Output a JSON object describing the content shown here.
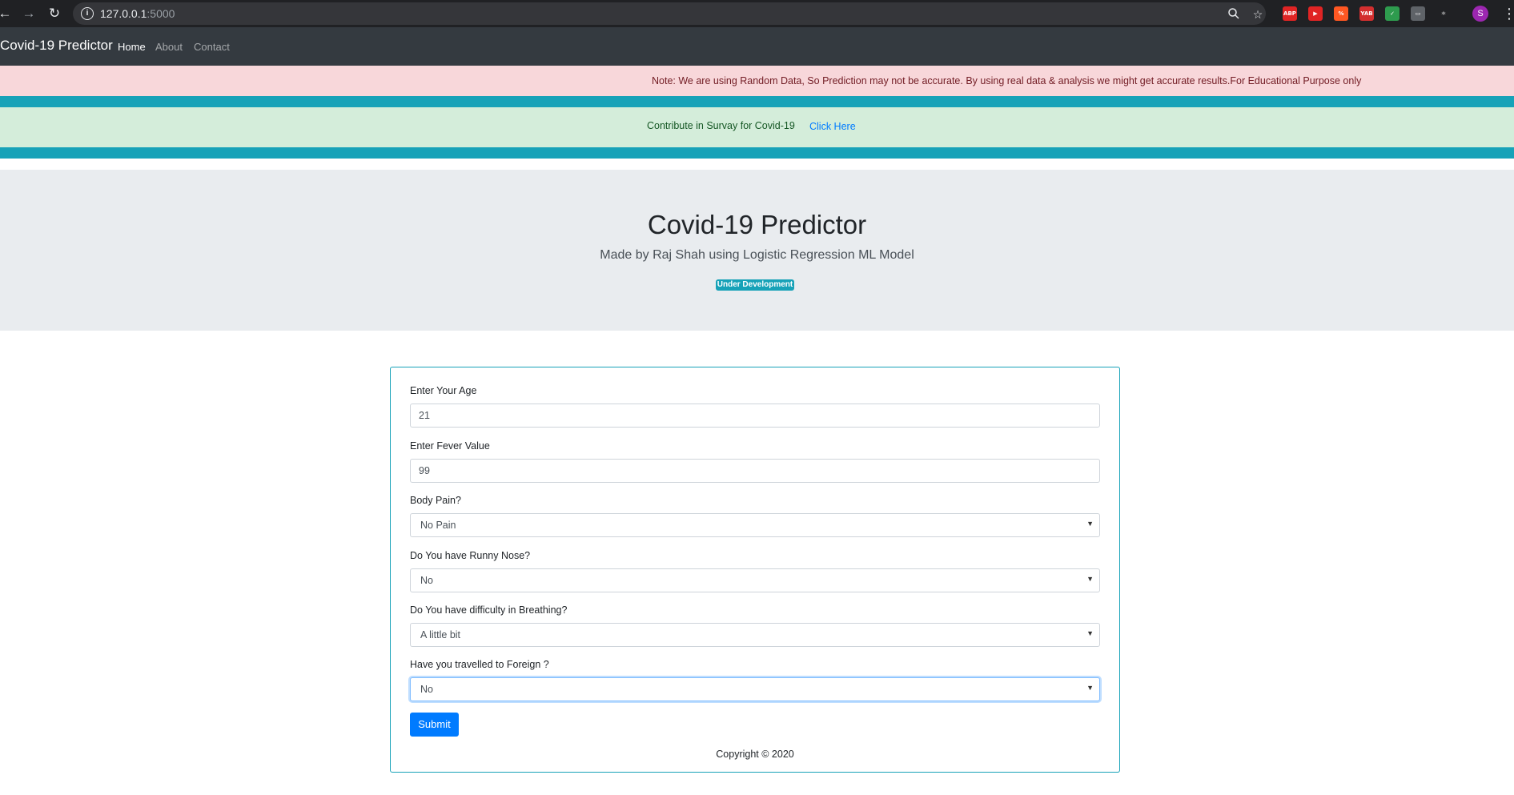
{
  "browser": {
    "url_host": "127.0.0.1",
    "url_port": ":5000",
    "profile_initial": "S",
    "extensions": [
      {
        "name": "adblock-plus-icon",
        "label": "ABP",
        "color": "#e02424"
      },
      {
        "name": "video-extension-icon",
        "label": "▶",
        "color": "#e02424"
      },
      {
        "name": "percent-extension-icon",
        "label": "%",
        "color": "#ff5722"
      },
      {
        "name": "yab-extension-icon",
        "label": "YAB",
        "color": "#d32f2f"
      },
      {
        "name": "shield-extension-icon",
        "label": "✓",
        "color": "#2e9b4e"
      },
      {
        "name": "media-extension-icon",
        "label": "▭",
        "color": "#5f6368"
      },
      {
        "name": "react-devtools-icon",
        "label": "⚛",
        "color": "#202124"
      }
    ]
  },
  "navbar": {
    "brand": "Covid-19 Predictor",
    "links": [
      "Home",
      "About",
      "Contact"
    ]
  },
  "alerts": {
    "note": "Note: We are using Random Data, So Prediction may not be accurate. By using real data & analysis we might get accurate results.For Educational Purpose only",
    "survey_text": "Contribute in Survay for Covid-19",
    "survey_link": "Click Here"
  },
  "jumbotron": {
    "title": "Covid-19 Predictor",
    "subtitle": "Made by Raj Shah using Logistic Regression ML Model",
    "badge": "Under Development"
  },
  "form": {
    "age_label": "Enter Your Age",
    "age_value": "21",
    "fever_label": "Enter Fever Value",
    "fever_value": "99",
    "body_pain_label": "Body Pain?",
    "body_pain_value": "No Pain",
    "runny_nose_label": "Do You have Runny Nose?",
    "runny_nose_value": "No",
    "breathing_label": "Do You have difficulty in Breathing?",
    "breathing_value": "A little bit",
    "travel_label": "Have you travelled to Foreign ?",
    "travel_value": "No",
    "submit_label": "Submit"
  },
  "footer": {
    "copyright": "Copyright © 2020"
  }
}
